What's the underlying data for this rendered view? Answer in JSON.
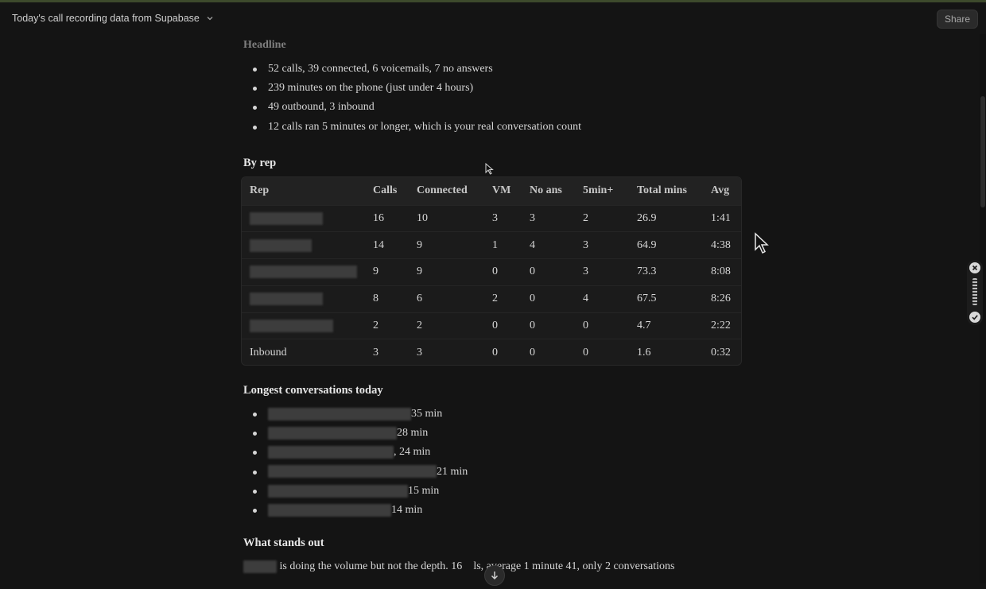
{
  "header": {
    "title": "Today's call recording data from Supabase",
    "share_label": "Share"
  },
  "headline": {
    "title": "Headline",
    "bullets": [
      "52 calls, 39 connected, 6 voicemails, 7 no answers",
      "239 minutes on the phone (just under 4 hours)",
      "49 outbound, 3 inbound",
      "12 calls ran 5 minutes or longer, which is your real conversation count"
    ]
  },
  "by_rep": {
    "title": "By rep",
    "columns": [
      "Rep",
      "Calls",
      "Connected",
      "VM",
      "No ans",
      "5min+",
      "Total mins",
      "Avg"
    ],
    "rows": [
      {
        "rep": "",
        "calls": "16",
        "connected": "10",
        "vm": "3",
        "no_ans": "3",
        "five_min": "2",
        "total_mins": "26.9",
        "avg": "1:41"
      },
      {
        "rep": "",
        "calls": "14",
        "connected": "9",
        "vm": "1",
        "no_ans": "4",
        "five_min": "3",
        "total_mins": "64.9",
        "avg": "4:38"
      },
      {
        "rep": "",
        "calls": "9",
        "connected": "9",
        "vm": "0",
        "no_ans": "0",
        "five_min": "3",
        "total_mins": "73.3",
        "avg": "8:08"
      },
      {
        "rep": "",
        "calls": "8",
        "connected": "6",
        "vm": "2",
        "no_ans": "0",
        "five_min": "4",
        "total_mins": "67.5",
        "avg": "8:26"
      },
      {
        "rep": "",
        "calls": "2",
        "connected": "2",
        "vm": "0",
        "no_ans": "0",
        "five_min": "0",
        "total_mins": "4.7",
        "avg": "2:22"
      },
      {
        "rep": "Inbound",
        "calls": "3",
        "connected": "3",
        "vm": "0",
        "no_ans": "0",
        "five_min": "0",
        "total_mins": "1.6",
        "avg": "0:32"
      }
    ]
  },
  "longest": {
    "title": "Longest conversations today",
    "items": [
      "35 min",
      "28 min",
      ", 24 min",
      "21 min",
      "15 min",
      "14 min"
    ]
  },
  "standout": {
    "title": "What stands out",
    "text_a": "is doing the volume but not the depth. 16",
    "text_b": "ls, average 1 minute 41, only 2 conversations"
  },
  "icons": {
    "chevron": "chevron-down-icon",
    "scroll_down": "arrow-down-icon",
    "close": "close-icon",
    "confirm": "check-icon"
  }
}
